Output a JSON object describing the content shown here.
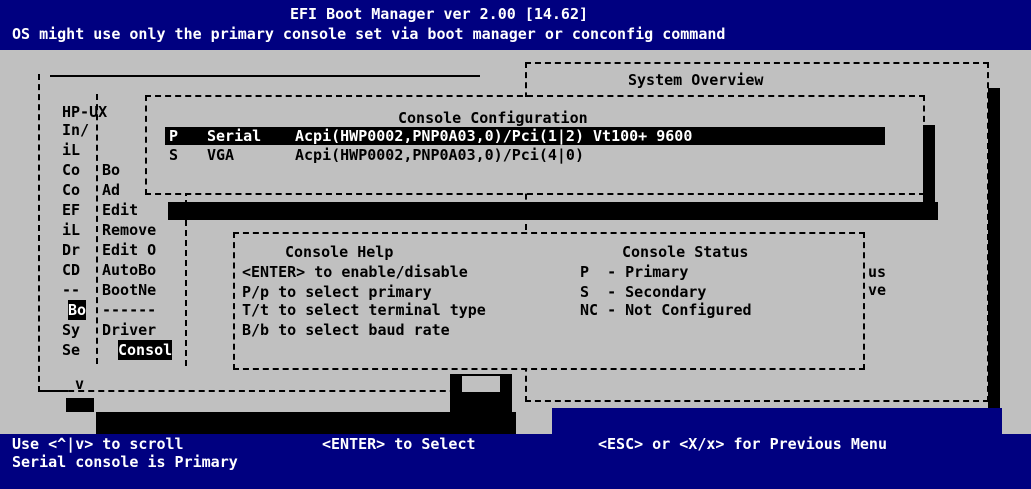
{
  "header": {
    "title": "EFI Boot Manager ver 2.00 [14.62]",
    "subtitle": "OS might use only the primary console set via boot manager or conconfig command"
  },
  "main_menu": {
    "items": [
      "HP-UX",
      "In/",
      "iL",
      "Co",
      "Co",
      "EF",
      "iL",
      "Dr",
      "CD",
      "--",
      "Bo",
      "Sy",
      "Se"
    ],
    "scroll_indicator": "v"
  },
  "boot_config_menu": {
    "items": [
      "Bo",
      "Ad",
      "Edit",
      "Remove",
      "Edit O",
      "AutoBo",
      "BootNe",
      "------",
      "Driver",
      "Consol"
    ]
  },
  "system_overview": {
    "title": "System Overview",
    "fragments": [
      "us",
      "ve"
    ]
  },
  "console_config": {
    "title": "Console Configuration",
    "entries": [
      {
        "flag": "P",
        "type": "Serial",
        "path": "Acpi(HWP0002,PNP0A03,0)/Pci(1|2) Vt100+ 9600",
        "selected": true
      },
      {
        "flag": "S",
        "type": "VGA",
        "path": "Acpi(HWP0002,PNP0A03,0)/Pci(4|0)",
        "selected": false
      }
    ]
  },
  "console_help": {
    "title": "Console Help",
    "lines": [
      "<ENTER> to enable/disable",
      "P/p to select primary",
      "T/t to select terminal type",
      "B/b to select baud rate"
    ]
  },
  "console_status": {
    "title": "Console Status",
    "lines": [
      "P  - Primary",
      "S  - Secondary",
      "NC - Not Configured"
    ]
  },
  "footer": {
    "scroll_hint": "Use <^|v> to scroll",
    "select_hint": "<ENTER> to Select",
    "back_hint": "<ESC> or <X/x> for Previous Menu",
    "status_message": "Serial console is Primary"
  },
  "colors": {
    "screen_bg": "#c0c0c0",
    "bar_bg": "#000080",
    "highlight": "#000000",
    "text_on_bar": "#ffffff"
  }
}
